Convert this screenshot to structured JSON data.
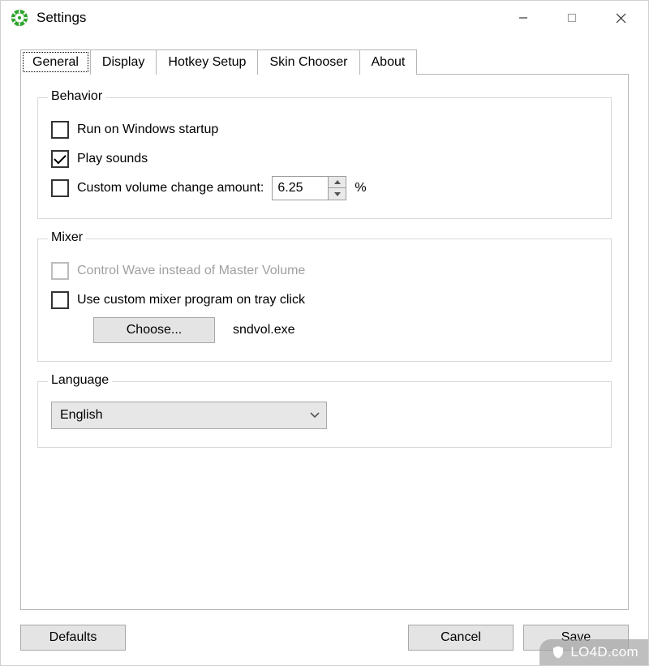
{
  "window": {
    "title": "Settings"
  },
  "tabs": {
    "general": "General",
    "display": "Display",
    "hotkey": "Hotkey Setup",
    "skin": "Skin Chooser",
    "about": "About"
  },
  "behavior": {
    "legend": "Behavior",
    "run_on_startup": "Run on Windows startup",
    "play_sounds": "Play sounds",
    "custom_volume_label": "Custom volume change amount:",
    "custom_volume_value": "6.25",
    "percent_symbol": "%"
  },
  "mixer": {
    "legend": "Mixer",
    "control_wave": "Control Wave instead of Master Volume",
    "use_custom_mixer": "Use custom mixer program on tray click",
    "choose_button": "Choose...",
    "program_value": "sndvol.exe"
  },
  "language": {
    "legend": "Language",
    "selected": "English"
  },
  "buttons": {
    "defaults": "Defaults",
    "cancel": "Cancel",
    "save": "Save"
  },
  "watermark": {
    "text": "LO4D.com"
  }
}
